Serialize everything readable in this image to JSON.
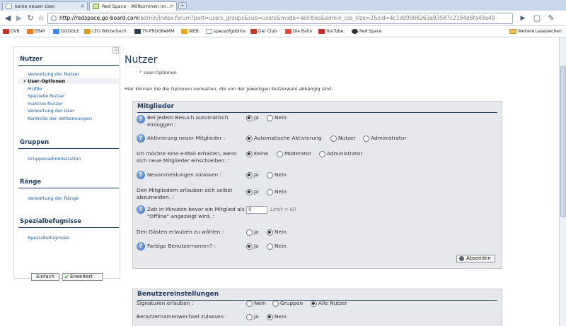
{
  "browser": {
    "tabs": [
      {
        "label": "keine neuen User",
        "active": false
      },
      {
        "label": "Red Space - Willkommen im...",
        "active": true
      }
    ],
    "new_tab_label": "+",
    "url_host": "http://redspace.go-board.com",
    "url_rest": "/admin/index.forum?part=users_groups&sub=users&mode=abilities&admin_css_size=2&sid=4c1dd9908263a93587c2194d6fa49a49",
    "bookmarks": [
      {
        "label": "DVB",
        "icon_color": "#c0392b",
        "icon_text": "DVB"
      },
      {
        "label": "EBAY",
        "icon_color": "#e67e22",
        "icon_text": "e"
      },
      {
        "label": "GOOGLE",
        "icon_color": "#4285f4",
        "icon_text": "G"
      },
      {
        "label": "LEO Wörterbuch",
        "icon_color": "#d4a017",
        "icon_text": "L"
      },
      {
        "label": "TV-PROGRAMM",
        "icon_color": "#2c3e50",
        "icon_text": "TV"
      },
      {
        "label": "WEB",
        "icon_color": "#e1a826",
        "icon_text": "W"
      },
      {
        "label": "spaceofgoblins",
        "icon_color": "#95a5a6",
        "icon_text": ""
      },
      {
        "label": "Der Club",
        "icon_color": "#c0392b",
        "icon_text": "Club"
      },
      {
        "label": "Die Bahn",
        "icon_color": "#e74c3c",
        "icon_text": "DB"
      },
      {
        "label": "YouTube",
        "icon_color": "#c4302b",
        "icon_text": "▶"
      },
      {
        "label": "Red Space",
        "icon_color": "#333",
        "icon_text": "S"
      }
    ],
    "bookmarks_other": "Weitere Lesezeichen"
  },
  "sidebar": {
    "sections": [
      {
        "title": "Nutzer",
        "items": [
          {
            "label": "Verwaltung der Nutzer",
            "active": false
          },
          {
            "label": "User-Optionen",
            "active": true
          },
          {
            "label": "Profile",
            "active": false
          },
          {
            "label": "Spezielle Nutzer",
            "active": false
          },
          {
            "label": "Inaktive Nutzer",
            "active": false
          },
          {
            "label": "Verwaltung der User",
            "active": false
          },
          {
            "label": "Kontrolle der Verbannungen",
            "active": false
          }
        ]
      },
      {
        "title": "Gruppen",
        "items": [
          {
            "label": "Gruppenadministration",
            "active": false
          }
        ]
      },
      {
        "title": "Ränge",
        "items": [
          {
            "label": "Verwaltung der Ränge",
            "active": false
          }
        ]
      },
      {
        "title": "Spezialbefugnisse",
        "items": [
          {
            "label": "Spezialbefugnisse",
            "active": false
          }
        ]
      }
    ],
    "btn_simple": "Einfach",
    "btn_extended": "Erweitert"
  },
  "main": {
    "title": "Nutzer",
    "subnav": "User-Optionen",
    "intro": "Hier können Sie die Optionen verwalten, die von der jeweiligen Nutzerwahl abhängig sind.",
    "panels": [
      {
        "title": "Mitglieder",
        "rows": [
          {
            "label": "Bei jedem Besuch automatisch einloggen :",
            "help": true,
            "options": [
              {
                "label": "Ja",
                "on": true
              },
              {
                "label": "Nein",
                "on": false
              }
            ]
          },
          {
            "label": "Aktivierung neuer Mitglieder :",
            "help": true,
            "options": [
              {
                "label": "Automatische Aktivierung",
                "on": true
              },
              {
                "label": "Nutzer",
                "on": false
              },
              {
                "label": "Administrator",
                "on": false
              }
            ]
          },
          {
            "label": "Ich möchte eine e-Mail erhalten, wenn sich neue Mitglieder einschreiben. :",
            "help": false,
            "options": [
              {
                "label": "Keine",
                "on": true
              },
              {
                "label": "Moderator",
                "on": false
              },
              {
                "label": "Administrator",
                "on": false
              }
            ]
          },
          {
            "label": "Neuanmeldungen zulassen :",
            "help": true,
            "options": [
              {
                "label": "Ja",
                "on": true
              },
              {
                "label": "Nein",
                "on": false
              }
            ]
          },
          {
            "label": "Den Mitgliedern erlauben sich selbst abzumelden. :",
            "help": false,
            "options": [
              {
                "label": "Ja",
                "on": true
              },
              {
                "label": "Nein",
                "on": false
              }
            ]
          },
          {
            "label": "Zeit in Minuten bevor ein Mitglied als \"Offline\" angezeigt wird. :",
            "help": true,
            "input_value": "5",
            "limit_text": "Limit = 60"
          },
          {
            "label": "Den Gästen erlauben zu wählen :",
            "help": false,
            "options": [
              {
                "label": "Ja",
                "on": false
              },
              {
                "label": "Nein",
                "on": true
              }
            ]
          },
          {
            "label": "Farbige Benutzernamen? :",
            "help": true,
            "options": [
              {
                "label": "Ja",
                "on": true
              },
              {
                "label": "Nein",
                "on": false
              }
            ]
          }
        ],
        "submit_label": "Absenden"
      },
      {
        "title": "Benutzereinstellungen",
        "rows": [
          {
            "label": "Signaturen erlauben :",
            "help": false,
            "options": [
              {
                "label": "Nein",
                "on": false
              },
              {
                "label": "Gruppen",
                "on": false
              },
              {
                "label": "Alle Nutzer",
                "on": true
              }
            ]
          },
          {
            "label": "Benutzernamenwechsel zulassen :",
            "help": false,
            "options": [
              {
                "label": "Ja",
                "on": false
              },
              {
                "label": "Nein",
                "on": true
              }
            ]
          }
        ]
      }
    ]
  }
}
